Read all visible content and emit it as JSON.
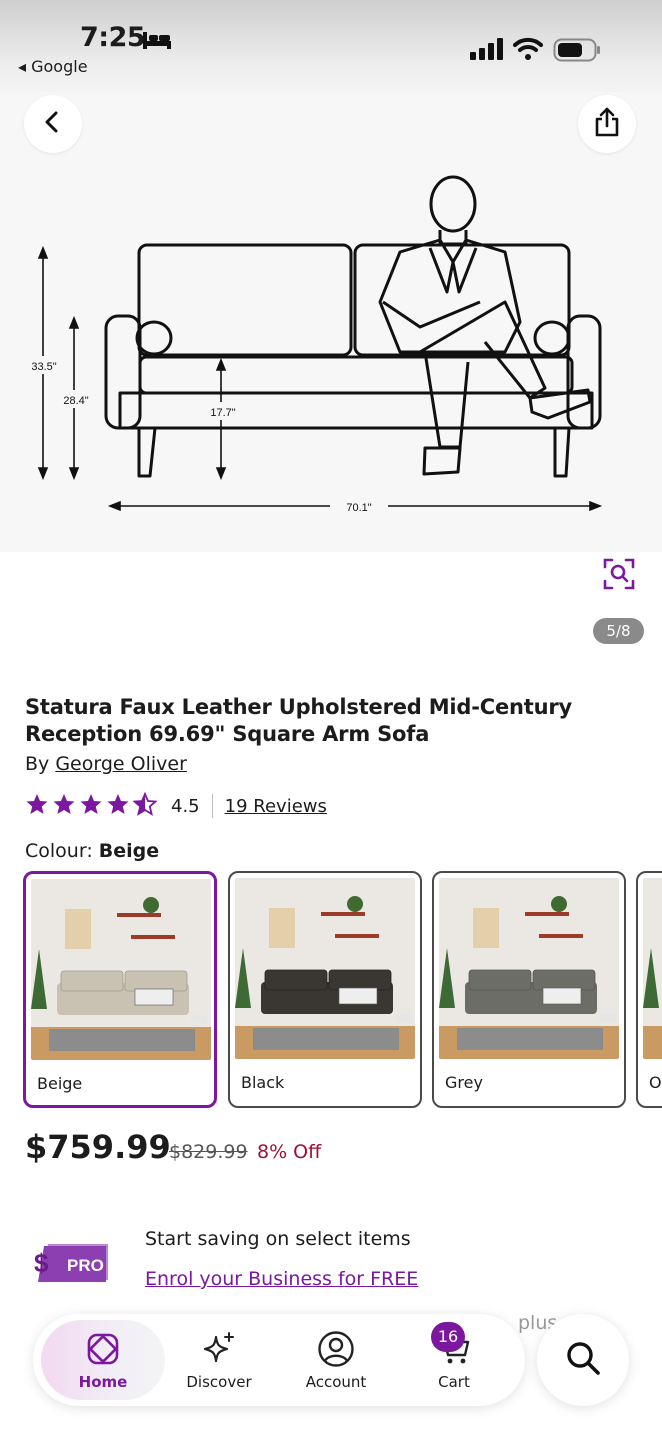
{
  "status_bar": {
    "time": "7:25",
    "back_app": "◂ Google"
  },
  "gallery": {
    "counter": "5/8",
    "dimensions": {
      "height_total": "33.5\"",
      "height_arm": "28.4\"",
      "seat_height": "17.7\"",
      "width": "70.1\""
    }
  },
  "product": {
    "title": "Statura Faux Leather Upholstered Mid-Century Reception 69.69\" Square Arm Sofa",
    "by_prefix": "By",
    "brand": "George Oliver",
    "rating": "4.5",
    "rating_numeric": 4.5,
    "reviews": "19 Reviews",
    "colour_label": "Colour:",
    "colour_selected": "Beige",
    "swatches": [
      {
        "label": "Beige",
        "sofa_color": "#c9c2b2"
      },
      {
        "label": "Black",
        "sofa_color": "#3a3733"
      },
      {
        "label": "Grey",
        "sofa_color": "#6d6d68"
      },
      {
        "label": "O",
        "sofa_color": "#9a8f7e"
      }
    ],
    "price": "$759.99",
    "was_price": "$829.99",
    "discount": "8% Off"
  },
  "pro": {
    "badge": "PRO",
    "text": "Start saving on select items",
    "link": "Enrol your Business for FREE",
    "faded": "plus"
  },
  "nav": {
    "home": "Home",
    "discover": "Discover",
    "account": "Account",
    "cart": "Cart",
    "cart_count": "16"
  },
  "colors": {
    "accent": "#7b189f",
    "discount": "#9b1236"
  }
}
